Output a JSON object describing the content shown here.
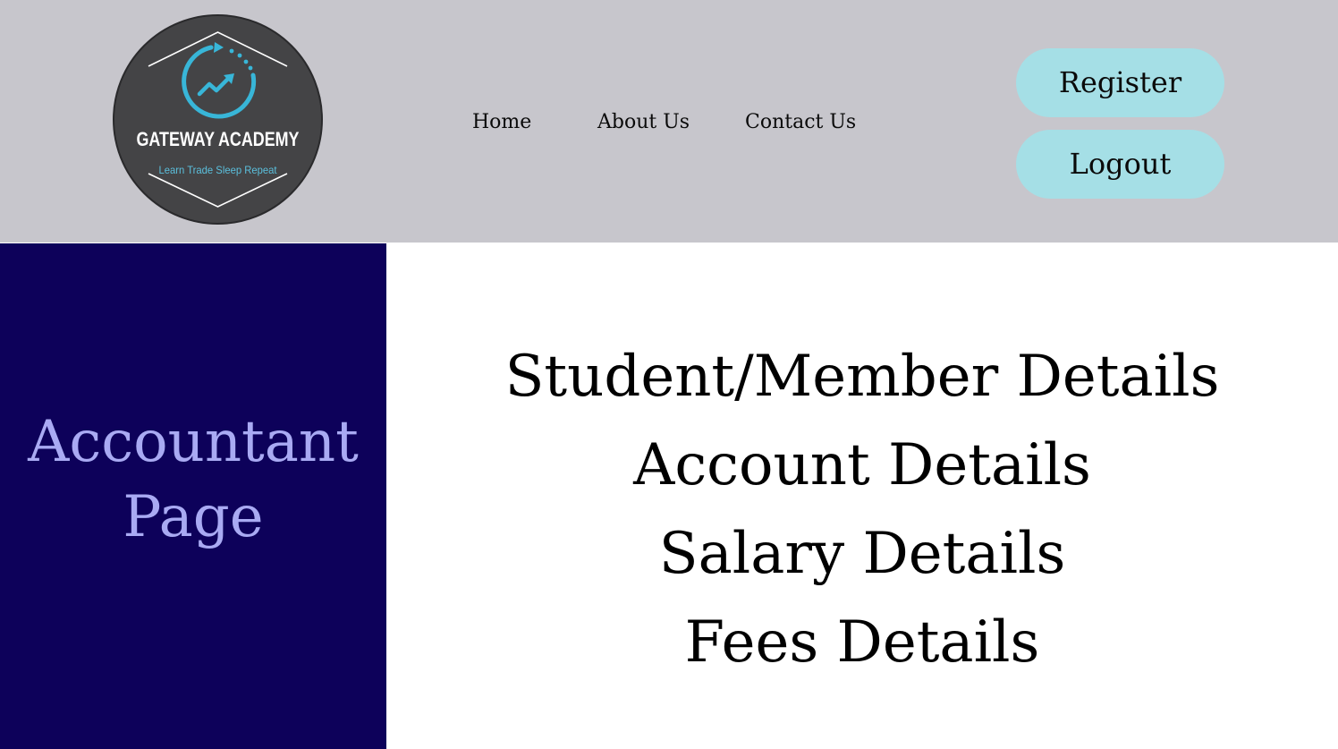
{
  "header": {
    "logo": {
      "title": "GATEWAY ACADEMY",
      "tagline": "Learn Trade Sleep Repeat",
      "icon": "trending-up-arrow-cycle-icon"
    },
    "nav": [
      "Home",
      "About Us",
      "Contact Us"
    ],
    "register_label": "Register",
    "logout_label": "Logout"
  },
  "sidebar": {
    "title_line1": "Accountant",
    "title_line2": "Page"
  },
  "main": {
    "links": [
      "Student/Member Details",
      "Account Details",
      "Salary Details",
      "Fees Details"
    ]
  },
  "colors": {
    "header_bg": "#c7c6cc",
    "button_bg": "#a5dfe6",
    "sidebar_bg": "#0d015a",
    "sidebar_text": "#a9aaf3",
    "logo_bg": "#444446",
    "logo_accent": "#38b6d8"
  }
}
